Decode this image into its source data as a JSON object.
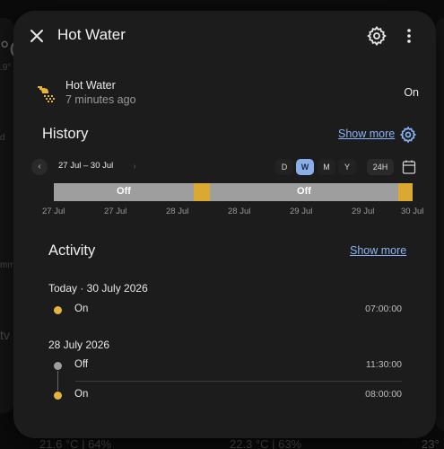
{
  "background": {
    "left_temp": "°C",
    "left_sub": ".9°",
    "left_d": "d",
    "left_mm": "mm",
    "left_tv": "tv",
    "bottom_left": "21.6 °C | 64%",
    "bottom_mid": "22.3 °C | 63%",
    "bottom_right": "23°"
  },
  "dialog": {
    "title": "Hot Water"
  },
  "entity": {
    "name": "Hot Water",
    "last_changed": "7 minutes ago",
    "state": "On",
    "icon": "shower-icon",
    "icon_color": "#e6b33d"
  },
  "history": {
    "title": "History",
    "show_more": "Show more",
    "date_range": "27 Jul – 30 Jul",
    "prev": "‹",
    "next": "›",
    "periods": [
      "D",
      "W",
      "M",
      "Y"
    ],
    "active_period": "W",
    "h24": "24H",
    "timeline": {
      "segments": [
        {
          "state": "Off",
          "start": 0.0,
          "end": 0.39,
          "color": "#9e9e9e",
          "label": "Off"
        },
        {
          "state": "On",
          "start": 0.39,
          "end": 0.435,
          "color": "#d9a932",
          "label": ""
        },
        {
          "state": "Off",
          "start": 0.435,
          "end": 0.96,
          "color": "#9e9e9e",
          "label": "Off"
        },
        {
          "state": "On",
          "start": 0.96,
          "end": 1.0,
          "color": "#d9a932",
          "label": ""
        }
      ],
      "ticks": [
        "27 Jul",
        "27 Jul",
        "28 Jul",
        "28 Jul",
        "29 Jul",
        "29 Jul",
        "30 Jul"
      ]
    }
  },
  "activity": {
    "title": "Activity",
    "show_more": "Show more",
    "groups": [
      {
        "day": "Today · 30 July 2026",
        "entries": [
          {
            "state": "On",
            "time": "07:00:00",
            "color": "#e6b33d"
          }
        ]
      },
      {
        "day": "28 July 2026",
        "entries": [
          {
            "state": "Off",
            "time": "11:30:00",
            "color": "#9e9e9e"
          },
          {
            "state": "On",
            "time": "08:00:00",
            "color": "#e6b33d"
          }
        ]
      }
    ]
  },
  "colors": {
    "accent": "#8ab4f8",
    "on": "#d9a932",
    "off": "#9e9e9e"
  }
}
